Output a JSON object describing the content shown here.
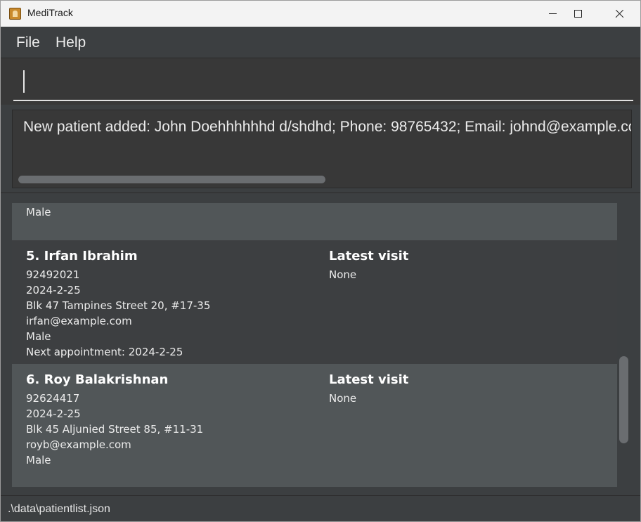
{
  "window": {
    "title": "MediTrack",
    "icon": "medical-record-icon"
  },
  "menu": {
    "file": "File",
    "help": "Help"
  },
  "command": {
    "value": ""
  },
  "result": {
    "message": "New patient added: John Doehhhhhhd d/shdhd; Phone: 98765432; Email: johnd@example.com"
  },
  "patients": {
    "partial": {
      "gender": "Male"
    },
    "p5": {
      "index_name": "5.  Irfan Ibrahim",
      "phone": "92492021",
      "date": "2024-2-25",
      "address": "Blk 47 Tampines Street 20, #17-35",
      "email": "irfan@example.com",
      "gender": "Male",
      "next_appointment": "Next appointment: 2024-2-25",
      "latest_visit_label": "Latest visit",
      "latest_visit_value": "None"
    },
    "p6": {
      "index_name": "6.  Roy Balakrishnan",
      "phone": "92624417",
      "date": "2024-2-25",
      "address": "Blk 45 Aljunied Street 85, #11-31",
      "email": "royb@example.com",
      "gender": "Male",
      "latest_visit_label": "Latest visit",
      "latest_visit_value": "None"
    }
  },
  "status": {
    "file_path": ".\\data\\patientlist.json"
  }
}
